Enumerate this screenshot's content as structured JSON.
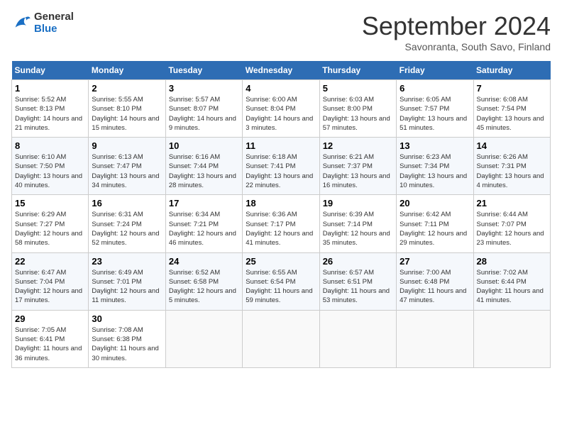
{
  "header": {
    "logo_line1": "General",
    "logo_line2": "Blue",
    "month": "September 2024",
    "location": "Savonranta, South Savo, Finland"
  },
  "days_of_week": [
    "Sunday",
    "Monday",
    "Tuesday",
    "Wednesday",
    "Thursday",
    "Friday",
    "Saturday"
  ],
  "weeks": [
    [
      {
        "day": "1",
        "rise": "5:52 AM",
        "set": "8:13 PM",
        "daylight": "14 hours and 21 minutes."
      },
      {
        "day": "2",
        "rise": "5:55 AM",
        "set": "8:10 PM",
        "daylight": "14 hours and 15 minutes."
      },
      {
        "day": "3",
        "rise": "5:57 AM",
        "set": "8:07 PM",
        "daylight": "14 hours and 9 minutes."
      },
      {
        "day": "4",
        "rise": "6:00 AM",
        "set": "8:04 PM",
        "daylight": "14 hours and 3 minutes."
      },
      {
        "day": "5",
        "rise": "6:03 AM",
        "set": "8:00 PM",
        "daylight": "13 hours and 57 minutes."
      },
      {
        "day": "6",
        "rise": "6:05 AM",
        "set": "7:57 PM",
        "daylight": "13 hours and 51 minutes."
      },
      {
        "day": "7",
        "rise": "6:08 AM",
        "set": "7:54 PM",
        "daylight": "13 hours and 45 minutes."
      }
    ],
    [
      {
        "day": "8",
        "rise": "6:10 AM",
        "set": "7:50 PM",
        "daylight": "13 hours and 40 minutes."
      },
      {
        "day": "9",
        "rise": "6:13 AM",
        "set": "7:47 PM",
        "daylight": "13 hours and 34 minutes."
      },
      {
        "day": "10",
        "rise": "6:16 AM",
        "set": "7:44 PM",
        "daylight": "13 hours and 28 minutes."
      },
      {
        "day": "11",
        "rise": "6:18 AM",
        "set": "7:41 PM",
        "daylight": "13 hours and 22 minutes."
      },
      {
        "day": "12",
        "rise": "6:21 AM",
        "set": "7:37 PM",
        "daylight": "13 hours and 16 minutes."
      },
      {
        "day": "13",
        "rise": "6:23 AM",
        "set": "7:34 PM",
        "daylight": "13 hours and 10 minutes."
      },
      {
        "day": "14",
        "rise": "6:26 AM",
        "set": "7:31 PM",
        "daylight": "13 hours and 4 minutes."
      }
    ],
    [
      {
        "day": "15",
        "rise": "6:29 AM",
        "set": "7:27 PM",
        "daylight": "12 hours and 58 minutes."
      },
      {
        "day": "16",
        "rise": "6:31 AM",
        "set": "7:24 PM",
        "daylight": "12 hours and 52 minutes."
      },
      {
        "day": "17",
        "rise": "6:34 AM",
        "set": "7:21 PM",
        "daylight": "12 hours and 46 minutes."
      },
      {
        "day": "18",
        "rise": "6:36 AM",
        "set": "7:17 PM",
        "daylight": "12 hours and 41 minutes."
      },
      {
        "day": "19",
        "rise": "6:39 AM",
        "set": "7:14 PM",
        "daylight": "12 hours and 35 minutes."
      },
      {
        "day": "20",
        "rise": "6:42 AM",
        "set": "7:11 PM",
        "daylight": "12 hours and 29 minutes."
      },
      {
        "day": "21",
        "rise": "6:44 AM",
        "set": "7:07 PM",
        "daylight": "12 hours and 23 minutes."
      }
    ],
    [
      {
        "day": "22",
        "rise": "6:47 AM",
        "set": "7:04 PM",
        "daylight": "12 hours and 17 minutes."
      },
      {
        "day": "23",
        "rise": "6:49 AM",
        "set": "7:01 PM",
        "daylight": "12 hours and 11 minutes."
      },
      {
        "day": "24",
        "rise": "6:52 AM",
        "set": "6:58 PM",
        "daylight": "12 hours and 5 minutes."
      },
      {
        "day": "25",
        "rise": "6:55 AM",
        "set": "6:54 PM",
        "daylight": "11 hours and 59 minutes."
      },
      {
        "day": "26",
        "rise": "6:57 AM",
        "set": "6:51 PM",
        "daylight": "11 hours and 53 minutes."
      },
      {
        "day": "27",
        "rise": "7:00 AM",
        "set": "6:48 PM",
        "daylight": "11 hours and 47 minutes."
      },
      {
        "day": "28",
        "rise": "7:02 AM",
        "set": "6:44 PM",
        "daylight": "11 hours and 41 minutes."
      }
    ],
    [
      {
        "day": "29",
        "rise": "7:05 AM",
        "set": "6:41 PM",
        "daylight": "11 hours and 36 minutes."
      },
      {
        "day": "30",
        "rise": "7:08 AM",
        "set": "6:38 PM",
        "daylight": "11 hours and 30 minutes."
      },
      null,
      null,
      null,
      null,
      null
    ]
  ],
  "labels": {
    "sunrise": "Sunrise:",
    "sunset": "Sunset:",
    "daylight": "Daylight hours"
  }
}
